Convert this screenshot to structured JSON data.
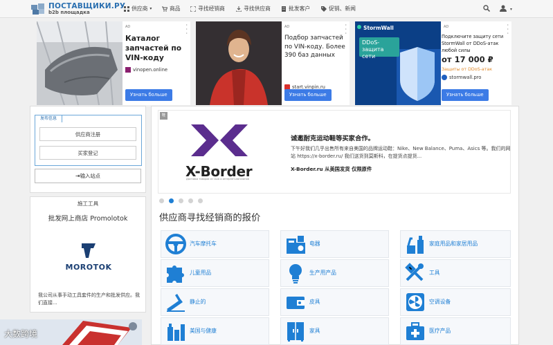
{
  "navbar": {
    "logo_title": "ПОСТАВЩИКИ.РУ",
    "logo_subtitle": "b2b площадка",
    "items": [
      {
        "label": "供应商",
        "icon": "grid-icon",
        "caret": "▾"
      },
      {
        "label": "商品",
        "icon": "cart-icon"
      },
      {
        "label": "寻找经销商",
        "icon": "expand-icon"
      },
      {
        "label": "寻找供应商",
        "icon": "download-icon"
      },
      {
        "label": "批发客户",
        "icon": "building-icon"
      },
      {
        "label": "促销、新闻",
        "icon": "tag-icon"
      }
    ],
    "user_caret": "▾"
  },
  "ads": [
    {
      "tag": "AD",
      "title": "Каталог запчастей по VIN-коду",
      "domain": "vinopen.online",
      "cta": "Узнать больше"
    },
    {
      "tag": "AD",
      "title": "Подбор запчастей по VIN-коду. Более 390 баз данных",
      "domain": "start.vinpin.ru",
      "cta": "Узнать больше"
    },
    {
      "tag": "AD",
      "title": "Подключите защиту сети StormWall от DDoS-атак любой силы",
      "price": "от 17 000 ₽",
      "promo": "Защиты от DDoS-атак",
      "domain": "stormwall.pro",
      "cta": "Узнать больше",
      "image_brand": "StormWall",
      "image_text": "DDoS-защита сети"
    }
  ],
  "left_panel": {
    "tab": "发布信息",
    "supplier_register": "供应商注册",
    "buyer_register": "买家登记",
    "login": "输入站点",
    "login_icon": "sign-in-icon"
  },
  "tools_card": {
    "title": "施工工具",
    "subtitle": "批发网上商店 Promolotok",
    "logo_text": "MOROTOK",
    "description": "我公司从事手动工具套件的生产和批发供应。我们直接..."
  },
  "banner": {
    "badge": "鞋",
    "logo_name": "X-Border",
    "logo_tagline": "Доставка товаров из США и интернет-магазинов",
    "title": "诚邀耐克运动鞋等买家合作。",
    "text": "下午好我们几乎出售所有来自美国的品牌运动鞋：Nike、New Balance、Puma、Asics 等。我们的网站 https://x-border.ru/ 我们送货到莫斯科，在提货点提货...",
    "site": "X-Border.ru 从美国发货 仅限原件",
    "active_dot": 1,
    "dot_count": 5
  },
  "section": {
    "title": "供应商寻找经销商的报价"
  },
  "categories": [
    {
      "label": "汽车摩托车",
      "icon": "steering-wheel-icon"
    },
    {
      "label": "电器",
      "icon": "appliances-icon"
    },
    {
      "label": "家庭用品和家居用品",
      "icon": "cleaning-icon"
    },
    {
      "label": "儿童用品",
      "icon": "puzzle-icon"
    },
    {
      "label": "生产用产品",
      "icon": "lightbulb-icon"
    },
    {
      "label": "工具",
      "icon": "tools-icon"
    },
    {
      "label": "静止的",
      "icon": "stationery-icon"
    },
    {
      "label": "皮具",
      "icon": "wallet-icon"
    },
    {
      "label": "空调设备",
      "icon": "fan-icon"
    },
    {
      "label": "美国与健康",
      "icon": "beauty-icon"
    },
    {
      "label": "家具",
      "icon": "wardrobe-icon"
    },
    {
      "label": "医疗产品",
      "icon": "medkit-icon"
    }
  ],
  "watermark": "大数跨境",
  "colors": {
    "accent": "#1f7fd4",
    "button": "#3c7be6",
    "brand": "#2a6fb0"
  }
}
